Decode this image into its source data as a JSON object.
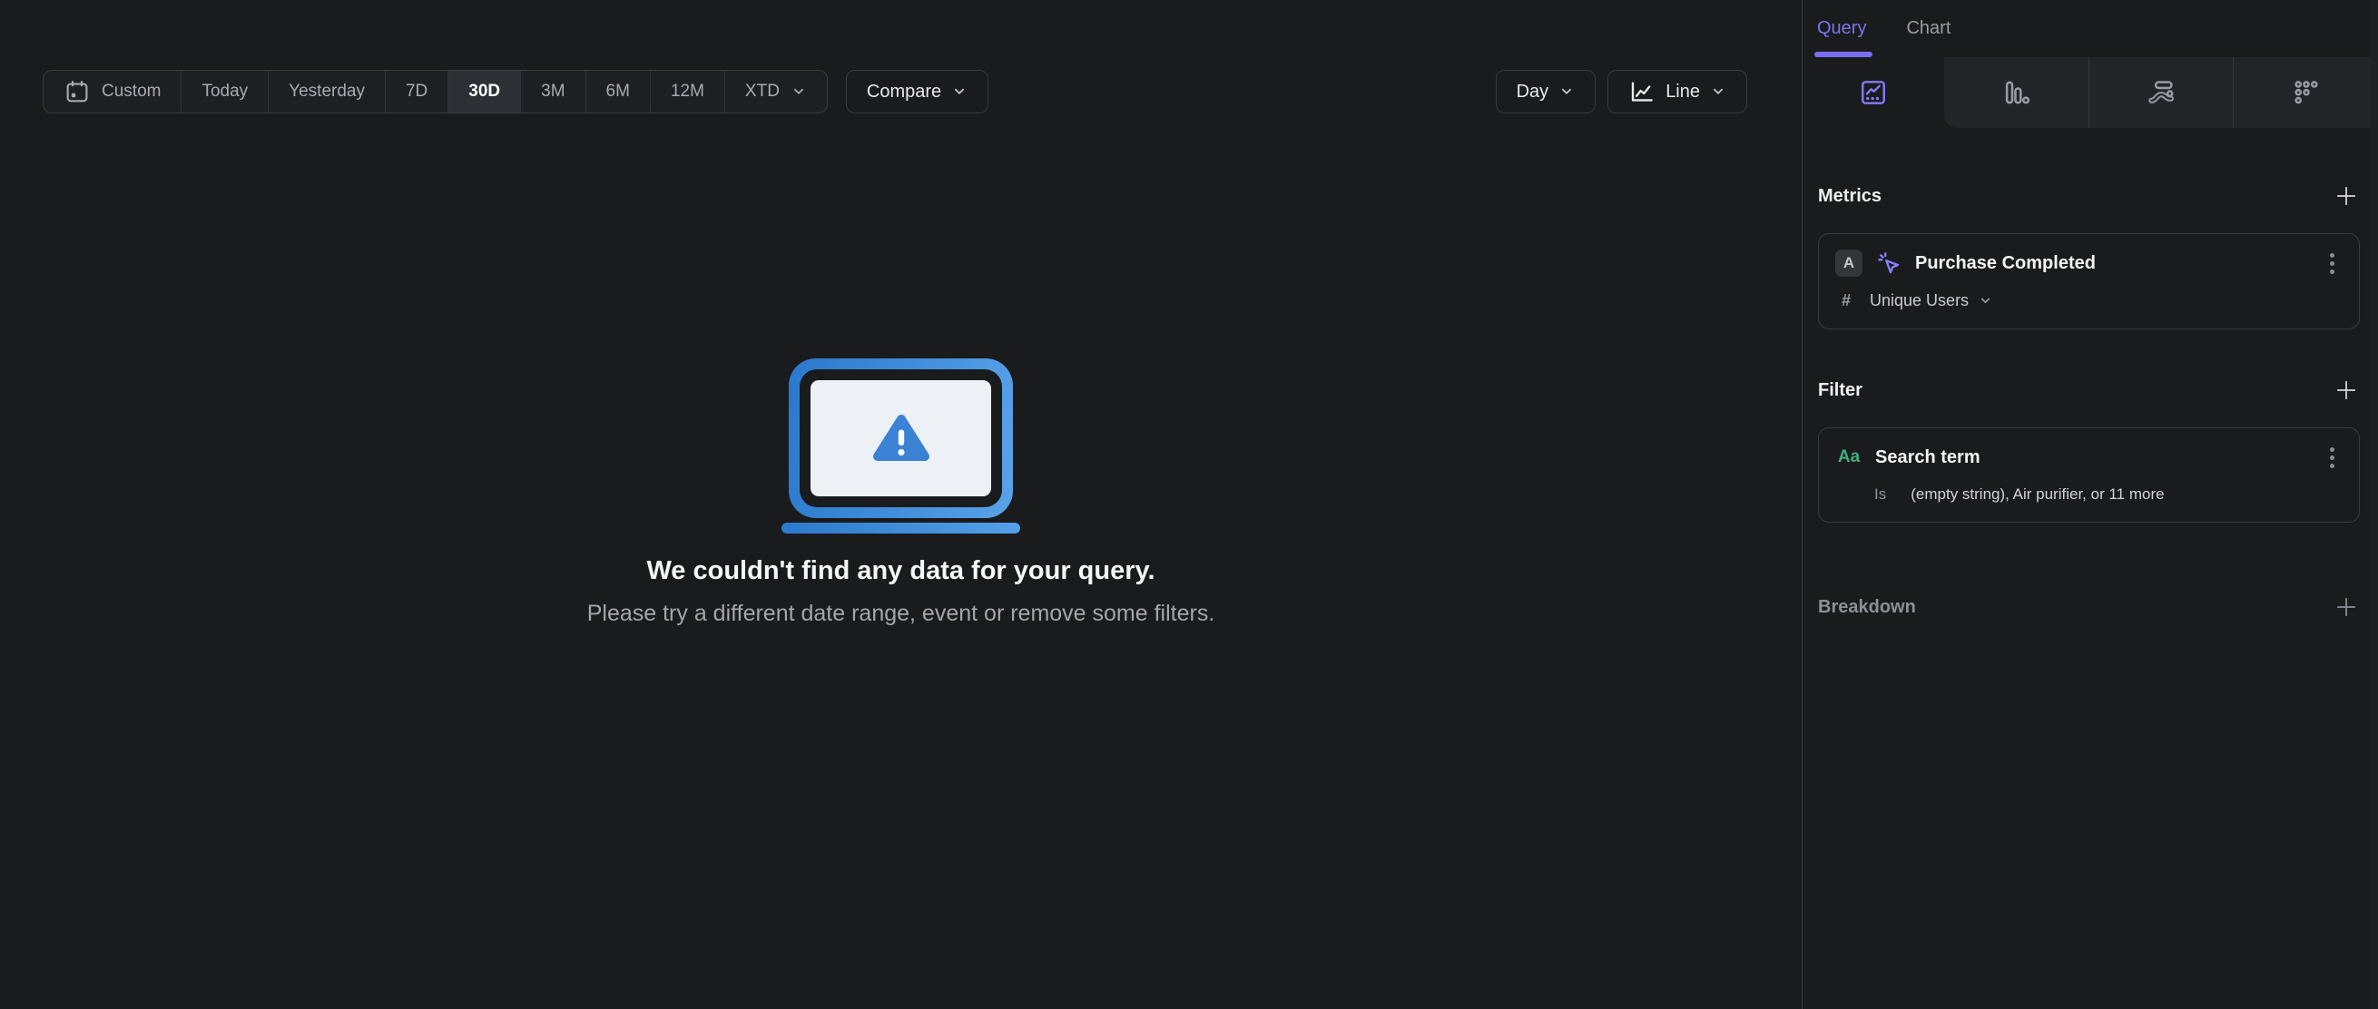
{
  "toolbar": {
    "date_ranges": [
      {
        "label": "Custom"
      },
      {
        "label": "Today"
      },
      {
        "label": "Yesterday"
      },
      {
        "label": "7D"
      },
      {
        "label": "30D"
      },
      {
        "label": "3M"
      },
      {
        "label": "6M"
      },
      {
        "label": "12M"
      },
      {
        "label": "XTD"
      }
    ],
    "selected_range": "30D",
    "compare_label": "Compare",
    "granularity_label": "Day",
    "chart_style_label": "Line"
  },
  "empty_state": {
    "title": "We couldn't find any data for your query.",
    "subtitle": "Please try a different date range, event or remove some filters."
  },
  "sidebar": {
    "tabs": [
      {
        "label": "Query"
      },
      {
        "label": "Chart"
      }
    ],
    "active_tab": "Query",
    "chart_type_tabs": [
      "insights",
      "bar",
      "flows",
      "retention"
    ],
    "active_chart_type": "insights",
    "metrics": {
      "heading": "Metrics",
      "item": {
        "series_letter": "A",
        "event_name": "Purchase Completed",
        "count_symbol": "#",
        "aggregation": "Unique Users"
      }
    },
    "filter": {
      "heading": "Filter",
      "item": {
        "type_label": "Aa",
        "property": "Search term",
        "operator": "Is",
        "values_summary": "(empty string), Air purifier, or 11 more"
      }
    },
    "breakdown": {
      "heading": "Breakdown"
    }
  },
  "icons": {
    "calendar-icon": "calendar outline",
    "chevron-down-icon": "v chevron",
    "line-chart-icon": "axis with zigzag line",
    "insights-tab-icon": "square with trend line and dots",
    "bar-tab-icon": "three descending bars",
    "flows-tab-icon": "pill, dot and s-curve",
    "retention-tab-icon": "triangle of dots",
    "cursor-click-icon": "pointer with rays",
    "plus-icon": "thin plus",
    "kebab-menu-icon": "three vertical dots",
    "warning-triangle-icon": "rounded triangle with exclamation",
    "laptop-icon": "blue laptop outline"
  },
  "colors": {
    "accent_purple": "#7a6ff0",
    "laptop_blue": "#3f8cda",
    "string_green": "#3fae7c",
    "background": "#1a1b1d"
  }
}
